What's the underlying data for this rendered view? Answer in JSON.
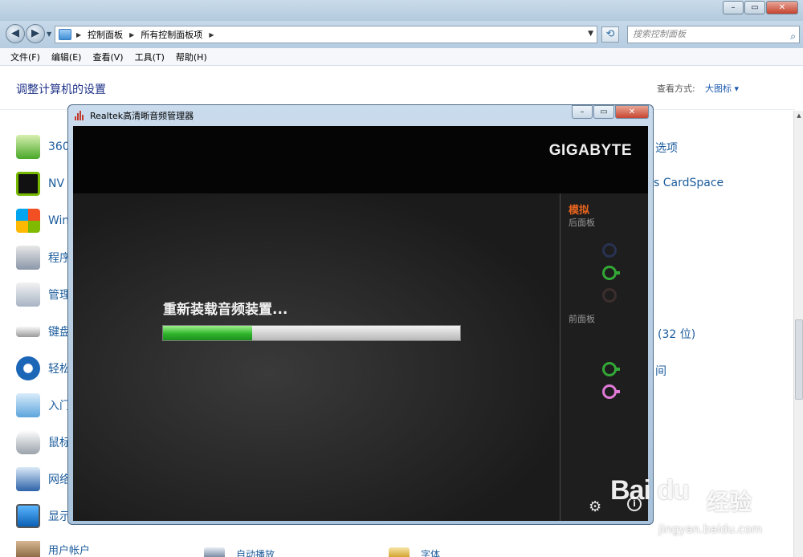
{
  "explorer": {
    "nav": {
      "path": [
        "控制面板",
        "所有控制面板项"
      ],
      "search_placeholder": "搜索控制面板"
    },
    "menu": [
      "文件(F)",
      "编辑(E)",
      "查看(V)",
      "工具(T)",
      "帮助(H)"
    ],
    "content": {
      "title": "调整计算机的设置",
      "view_by_label": "查看方式:",
      "view_by_value": "大图标",
      "left_items": [
        "360",
        "NV",
        "Win",
        "程序",
        "管理",
        "键盘",
        "轻松",
        "入门",
        "鼠标",
        "网络",
        "显示",
        "用户帐户"
      ],
      "right_items": [
        "选项",
        "s CardSpace",
        "(32 位)",
        "间"
      ],
      "bottom_items": [
        "自动播放",
        "字体"
      ]
    }
  },
  "dialog": {
    "title": "Realtek高清晰音频管理器",
    "brand": "GIGABYTE",
    "loading_text": "重新装载音频装置...",
    "progress": 0.3,
    "side": {
      "title": "模拟",
      "rear_label": "后面板",
      "front_label": "前面板",
      "rear_jacks": [
        {
          "color": "#2c3b66",
          "active": false
        },
        {
          "color": "#33a836",
          "active": true
        },
        {
          "color": "#4a3535",
          "active": false
        }
      ],
      "front_jacks": [
        {
          "color": "#33a836",
          "active": true
        },
        {
          "color": "#e07ad6",
          "active": true
        }
      ]
    }
  },
  "watermark": {
    "brand": "Bai du",
    "cn": "经验",
    "url": "jingyan.baidu.com"
  }
}
